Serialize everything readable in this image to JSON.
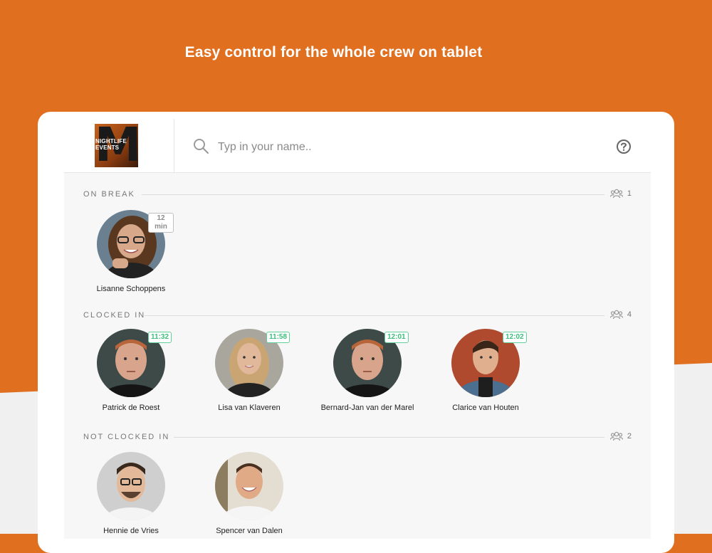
{
  "headline": "Easy control for the whole crew on tablet",
  "colors": {
    "brand_orange": "#e07020",
    "clocked_in_green": "#3bbf7a",
    "neutral": "#8c8c8c"
  },
  "logo": {
    "letter": "M",
    "text_line1": "NIGHTLIFE",
    "text_line2": "EVENTS"
  },
  "search": {
    "placeholder": "Typ in your name.."
  },
  "icons": {
    "search": "search-icon",
    "help": "help-icon",
    "group": "group-icon"
  },
  "sections": {
    "on_break": {
      "title": "ON BREAK",
      "count": "1",
      "people": [
        {
          "name": "Lisanne Schoppens",
          "badge": "12 min"
        }
      ]
    },
    "clocked_in": {
      "title": "CLOCKED IN",
      "count": "4",
      "people": [
        {
          "name": "Patrick de Roest",
          "badge": "11:32"
        },
        {
          "name": "Lisa van Klaveren",
          "badge": "11:58"
        },
        {
          "name": "Bernard-Jan van der Marel",
          "badge": "12:01"
        },
        {
          "name": "Clarice van Houten",
          "badge": "12:02"
        }
      ]
    },
    "not_clocked_in": {
      "title": "NOT CLOCKED IN",
      "count": "2",
      "people": [
        {
          "name": "Hennie de Vries"
        },
        {
          "name": "Spencer van Dalen"
        }
      ]
    }
  }
}
